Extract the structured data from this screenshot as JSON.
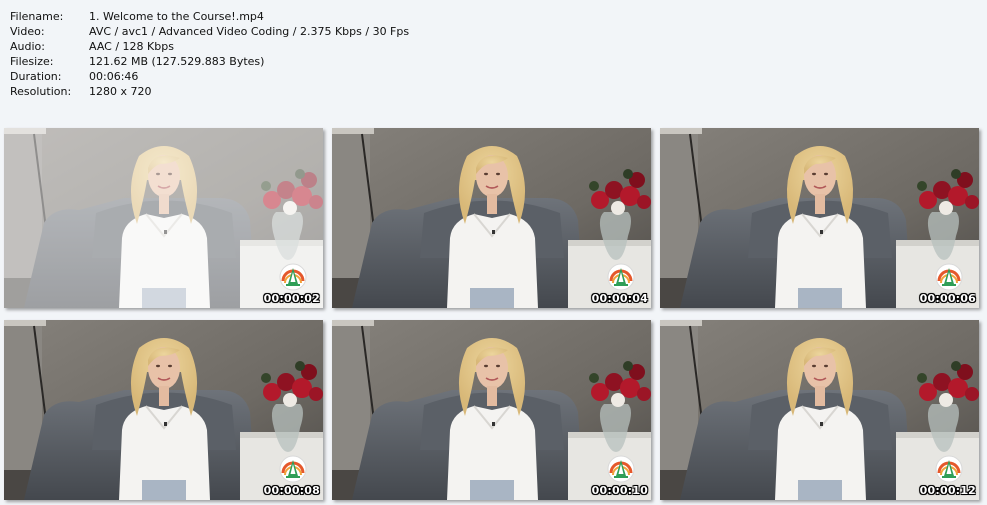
{
  "info": {
    "rows": [
      {
        "label": "Filename:",
        "value": "1. Welcome to the Course!.mp4"
      },
      {
        "label": "Video:",
        "value": "AVC / avc1 / Advanced Video Coding / 2.375 Kbps / 30 Fps"
      },
      {
        "label": "Audio:",
        "value": "AAC / 128 Kbps"
      },
      {
        "label": "Filesize:",
        "value": "121.62 MB (127.529.883 Bytes)"
      },
      {
        "label": "Duration:",
        "value": "00:06:46"
      },
      {
        "label": "Resolution:",
        "value": "1280 x 720"
      }
    ]
  },
  "thumbnails": [
    {
      "timestamp": "00:00:02",
      "faded": true
    },
    {
      "timestamp": "00:00:04",
      "faded": false
    },
    {
      "timestamp": "00:00:06",
      "faded": false
    },
    {
      "timestamp": "00:00:08",
      "faded": false
    },
    {
      "timestamp": "00:00:10",
      "faded": false
    },
    {
      "timestamp": "00:00:12",
      "faded": false
    }
  ],
  "colors": {
    "background": "#f2f5f8",
    "wall": "#6e6a64",
    "armchair": "#5d6168",
    "blouse": "#f4f3f1",
    "hair": "#d8b878",
    "roses": "#b3192b"
  },
  "icons": {
    "logo": "watermark-logo-icon"
  }
}
